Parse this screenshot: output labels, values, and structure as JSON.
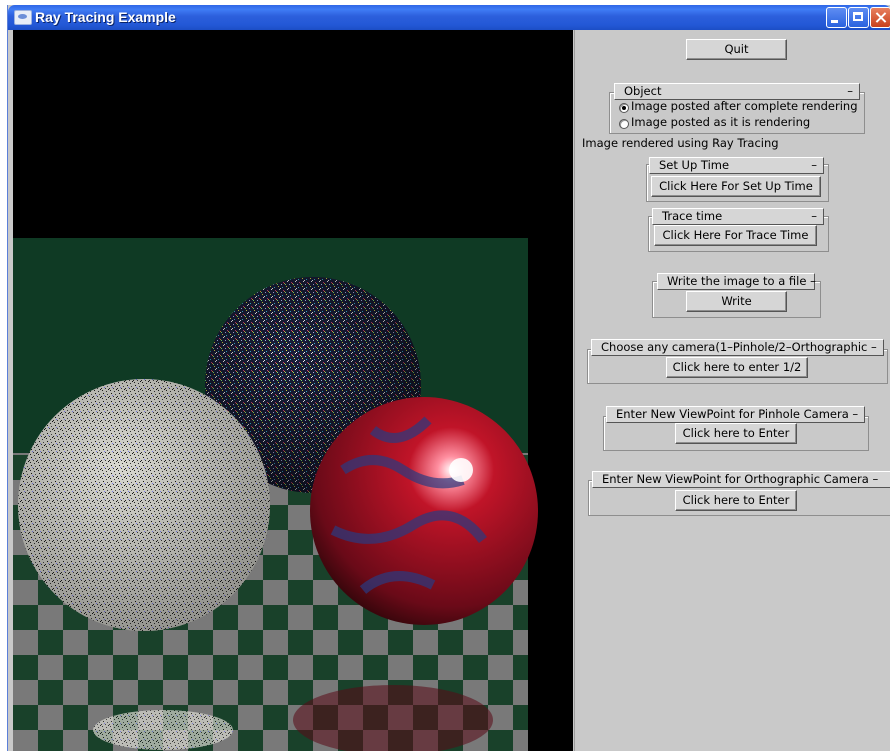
{
  "window": {
    "title": "Ray Tracing Example"
  },
  "controls": {
    "quit_label": "Quit",
    "object_group": {
      "title": "Object",
      "collapse_glyph": "–",
      "options": [
        {
          "label": "Image posted after complete rendering",
          "selected": true
        },
        {
          "label": "Image posted as it is rendering",
          "selected": false
        }
      ]
    },
    "status_text": "Image rendered using Ray Tracing",
    "setup_group": {
      "title": "Set Up Time",
      "collapse_glyph": "–",
      "button_label": "Click Here For Set Up Time"
    },
    "trace_group": {
      "title": "Trace time",
      "collapse_glyph": "–",
      "button_label": "Click Here For Trace Time"
    },
    "write_group": {
      "title": "Write the image to a file –",
      "button_label": "Write"
    },
    "camera_group": {
      "title": "Choose any camera(1–Pinhole/2–Orthographic –",
      "button_label": "Click here to enter 1/2"
    },
    "pinhole_group": {
      "title": "Enter New ViewPoint for Pinhole Camera –",
      "button_label": "Click here to Enter"
    },
    "ortho_group": {
      "title": "Enter New ViewPoint for Orthographic Camera –",
      "button_label": "Click here to Enter"
    }
  },
  "colors": {
    "titlebar": "#2358d6",
    "panel_bg": "#c9c9c9",
    "floor_green": "#1d4a30",
    "floor_gray": "#8a8a8a",
    "sphere_red": "#a01020",
    "sphere_blue_pattern": "#2a3a80"
  }
}
